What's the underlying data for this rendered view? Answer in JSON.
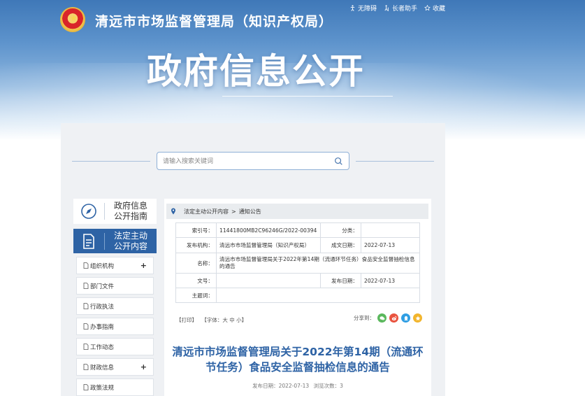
{
  "header": {
    "site_title": "清远市市场监督管理局（知识产权局）",
    "banner_title": "政府信息公开",
    "top_links": [
      {
        "label": "无障碍",
        "icon": "accessibility-icon"
      },
      {
        "label": "长者助手",
        "icon": "elder-helper-icon"
      },
      {
        "label": "收藏",
        "icon": "star-icon"
      }
    ]
  },
  "search": {
    "placeholder": "请输入搜索关键词",
    "value": ""
  },
  "sidebar": {
    "guide_label_line1": "政府信息",
    "guide_label_line2": "公开指南",
    "active_label_line1": "法定主动",
    "active_label_line2": "公开内容",
    "items": [
      {
        "label": "组织机构",
        "expandable": true
      },
      {
        "label": "部门文件",
        "expandable": false
      },
      {
        "label": "行政执法",
        "expandable": false
      },
      {
        "label": "办事指南",
        "expandable": false
      },
      {
        "label": "工作动态",
        "expandable": false
      },
      {
        "label": "财政信息",
        "expandable": true
      },
      {
        "label": "政策法规",
        "expandable": false
      }
    ],
    "plus_symbol": "+"
  },
  "breadcrumb": {
    "items": [
      "法定主动公开内容",
      ">",
      "通知公告"
    ]
  },
  "meta": {
    "index_label": "索引号：",
    "index_value": "11441800MB2C96246G/2022-00394",
    "category_label": "分类：",
    "category_value": "",
    "publisher_label": "发布机构：",
    "publisher_value": "清远市市场监督管理局（知识产权局）",
    "created_label": "成文日期：",
    "created_value": "2022-07-13",
    "name_label": "名称：",
    "name_value": "清远市市场监督管理局关于2022年第14期（流通环节任务）食品安全监督抽检信息的通告",
    "docno_label": "文号：",
    "docno_value": "",
    "published_label": "发布日期：",
    "published_value": "2022-07-13",
    "subject_label": "主题词：",
    "subject_value": ""
  },
  "tools": {
    "print": "【打印】",
    "font_prefix": "【字体：",
    "font_large": "大",
    "font_medium": "中",
    "font_small": "小",
    "font_suffix": "】",
    "share_label": "分享到："
  },
  "article": {
    "title": "清远市市场监督管理局关于2022年第14期（流通环节任务）食品安全监督抽检信息的通告",
    "date_label": "发布日期：2022-07-13",
    "views_label": "浏览次数：3"
  },
  "colors": {
    "brand_blue": "#2e63a5",
    "wechat": "#5bb85d",
    "weibo": "#e9533f",
    "qq": "#2f9ee3",
    "qzone": "#f2b52d"
  }
}
